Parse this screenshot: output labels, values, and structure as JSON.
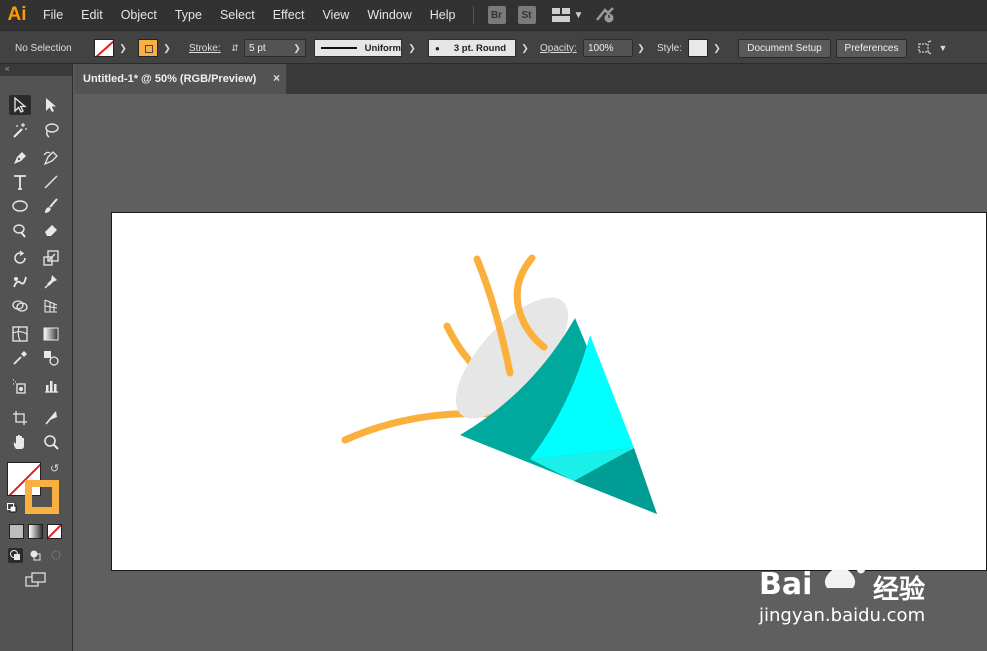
{
  "app": {
    "logo": "Ai"
  },
  "menu": [
    "File",
    "Edit",
    "Object",
    "Type",
    "Select",
    "Effect",
    "View",
    "Window",
    "Help"
  ],
  "app_switcher": {
    "bridge": "Br",
    "stock": "St"
  },
  "control_bar": {
    "selection_status": "No Selection",
    "stroke_label": "Stroke:",
    "stroke_weight": "5 pt",
    "profile": "Uniform",
    "brush": "3 pt. Round",
    "opacity_label": "Opacity:",
    "opacity_value": "100%",
    "style_label": "Style:",
    "document_setup": "Document Setup",
    "preferences": "Preferences"
  },
  "document_tab": {
    "title": "Untitled-1* @ 50% (RGB/Preview)",
    "close": "×"
  },
  "colors": {
    "fill": "none",
    "stroke": "#f9b040",
    "cone_cyan": "#00ffff",
    "cone_teal": "#00a99d",
    "cone_dark_teal": "#009d94",
    "rim_gray": "#e6e6e6",
    "streamer_orange": "#fbb03b"
  },
  "watermark": {
    "brand": "Bai",
    "brand2": "经验",
    "url": "jingyan.baidu.com"
  }
}
